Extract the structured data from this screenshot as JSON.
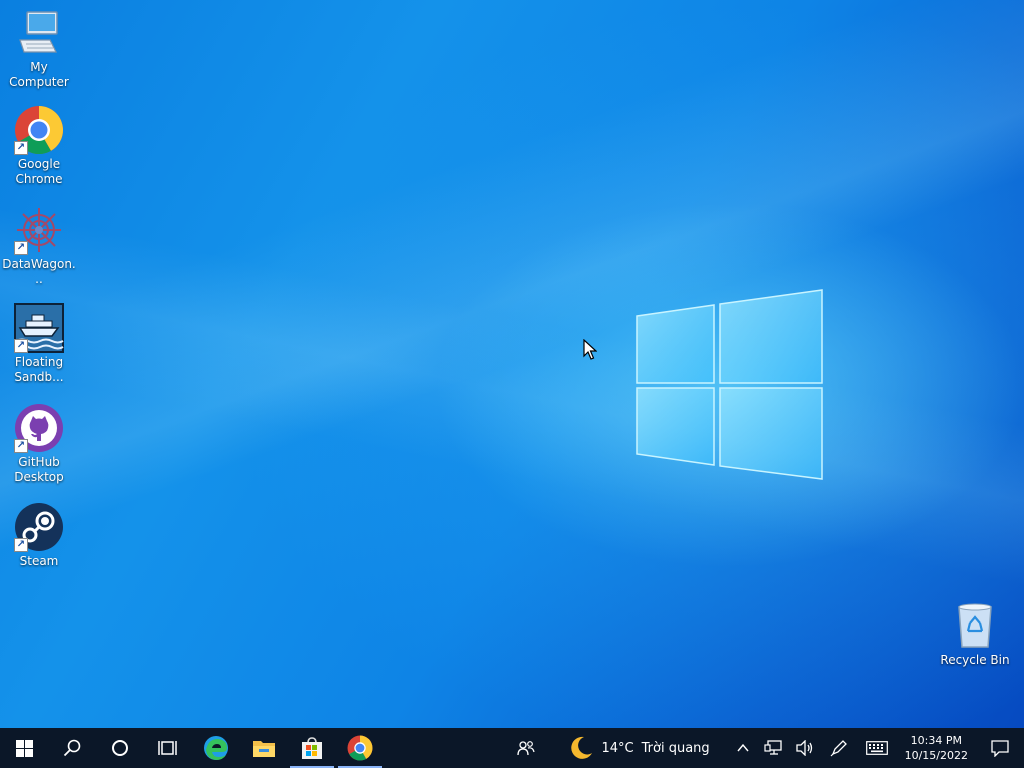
{
  "desktop": {
    "icons": [
      {
        "label": "My Computer",
        "icon": "computer-icon"
      },
      {
        "label": "Google Chrome",
        "icon": "chrome-icon",
        "shortcut": true
      },
      {
        "label": "DataWagon...",
        "icon": "datawagon-icon",
        "shortcut": true
      },
      {
        "label": "Floating Sandb...",
        "icon": "ship-icon",
        "shortcut": true
      },
      {
        "label": "GitHub Desktop",
        "icon": "github-icon",
        "shortcut": true
      },
      {
        "label": "Steam",
        "icon": "steam-icon",
        "shortcut": true
      }
    ],
    "recycle_bin": {
      "label": "Recycle Bin",
      "icon": "recycle-bin-icon"
    }
  },
  "taskbar": {
    "pinned": [
      {
        "name": "start",
        "icon": "windows-start-icon"
      },
      {
        "name": "search",
        "icon": "search-icon"
      },
      {
        "name": "cortana",
        "icon": "cortana-circle-icon"
      },
      {
        "name": "task-view",
        "icon": "task-view-icon"
      },
      {
        "name": "edge",
        "icon": "edge-icon"
      },
      {
        "name": "file-explorer",
        "icon": "folder-icon"
      },
      {
        "name": "store",
        "icon": "store-icon",
        "active": true
      },
      {
        "name": "chrome",
        "icon": "chrome-icon",
        "active": true
      }
    ],
    "weather": {
      "temperature": "14°C",
      "condition": "Trời quang",
      "icon": "moon-icon"
    },
    "tray_icons": [
      "people-icon",
      "chevron-up-icon",
      "network-icon",
      "volume-icon",
      "pen-icon",
      "keyboard-icon"
    ],
    "clock": {
      "time": "10:34 PM",
      "date": "10/15/2022"
    }
  },
  "colors": {
    "taskbar": "#0b1728",
    "active_indicator": "#8ab4f8",
    "desktop_accent": "#0a7fe0"
  }
}
